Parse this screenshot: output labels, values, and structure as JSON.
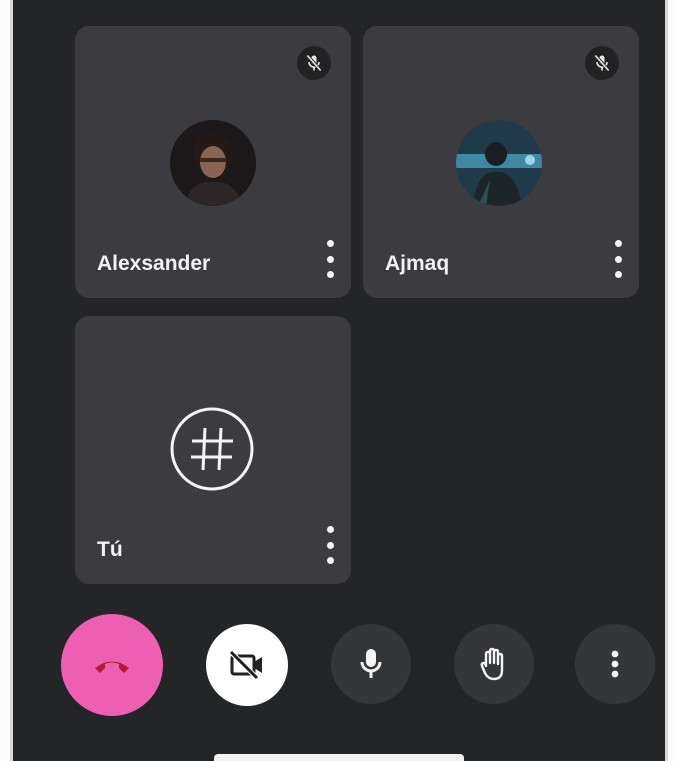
{
  "participants": [
    {
      "name": "Alexsander",
      "muted": true,
      "avatar": "profile-photo"
    },
    {
      "name": "Ajmaq",
      "muted": true,
      "avatar": "profile-photo"
    },
    {
      "name": "Tú",
      "avatar": "hashtag-icon"
    }
  ],
  "controls": [
    {
      "icon": "end-call-icon",
      "color": "#ec5fb3"
    },
    {
      "icon": "video-off-icon",
      "color": "#ffffff"
    },
    {
      "icon": "mic-icon",
      "color": "#35363a"
    },
    {
      "icon": "raise-hand-icon",
      "color": "#35363a"
    },
    {
      "icon": "more-vert-icon",
      "color": "#35363a"
    }
  ],
  "colors": {
    "background": "#242526",
    "tile": "#3b3b40",
    "end_call": "#ec5fb3"
  }
}
